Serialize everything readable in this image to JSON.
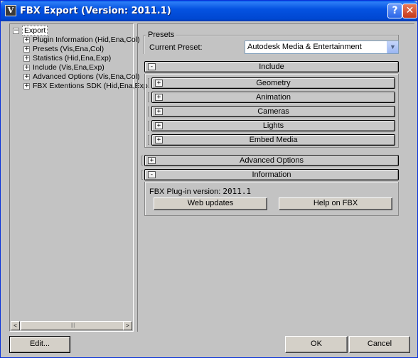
{
  "window": {
    "title": "FBX Export (Version: 2011.1)",
    "help_glyph": "?",
    "close_glyph": "✕",
    "app_icon_glyph": "V"
  },
  "tree": {
    "root": {
      "toggle": "−",
      "label": "Export"
    },
    "items": [
      {
        "toggle": "+",
        "label": "Plugin Information (Hid,Ena,Col)"
      },
      {
        "toggle": "+",
        "label": "Presets (Vis,Ena,Col)"
      },
      {
        "toggle": "+",
        "label": "Statistics (Hid,Ena,Exp)"
      },
      {
        "toggle": "+",
        "label": "Include (Vis,Ena,Exp)"
      },
      {
        "toggle": "+",
        "label": "Advanced Options (Vis,Ena,Col)"
      },
      {
        "toggle": "+",
        "label": "FBX Extentions SDK (Hid,Ena,Exp"
      }
    ],
    "scroll_left": "<",
    "scroll_right": ">",
    "scroll_grip": "|||"
  },
  "presets": {
    "group_label": "Presets",
    "current_label": "Current Preset:",
    "current_value": "Autodesk Media & Entertainment",
    "dropdown_glyph": "▼"
  },
  "include": {
    "toggle": "-",
    "label": "Include"
  },
  "include_sections": [
    {
      "toggle": "+",
      "label": "Geometry"
    },
    {
      "toggle": "+",
      "label": "Animation"
    },
    {
      "toggle": "+",
      "label": "Cameras"
    },
    {
      "toggle": "+",
      "label": "Lights"
    },
    {
      "toggle": "+",
      "label": "Embed Media"
    }
  ],
  "advanced": {
    "toggle": "+",
    "label": "Advanced Options"
  },
  "information": {
    "toggle": "-",
    "label": "Information",
    "version_label": "FBX Plug-in version:",
    "version_value": "2011.1",
    "web_updates": "Web updates",
    "help": "Help on FBX"
  },
  "footer": {
    "edit": "Edit...",
    "ok": "OK",
    "cancel": "Cancel"
  },
  "colors": {
    "titlebar": "#0553e1",
    "dialog_bg": "#c3c3c3",
    "rollout": "#c8c8c8"
  }
}
